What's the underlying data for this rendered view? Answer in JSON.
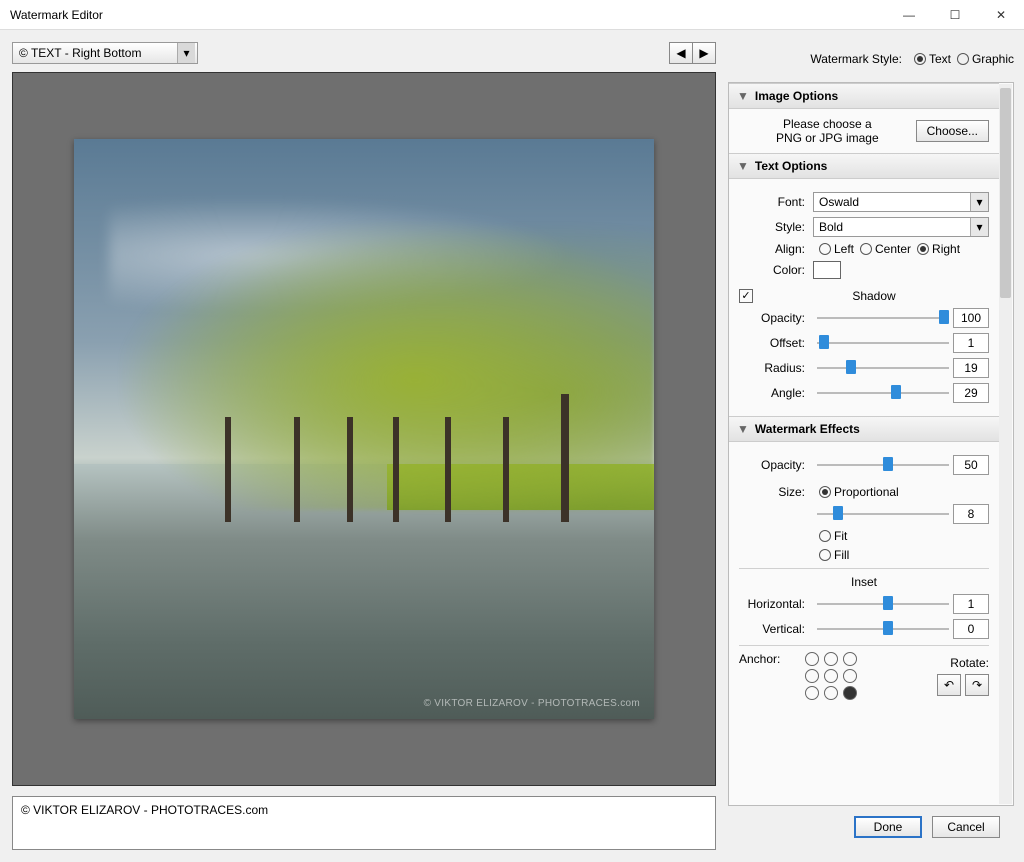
{
  "window": {
    "title": "Watermark Editor"
  },
  "preset": {
    "selected": "© TEXT - Right Bottom"
  },
  "watermarkText": "© VIKTOR ELIZAROV - PHOTOTRACES.com",
  "previewWatermark": "© VIKTOR ELIZAROV - PHOTOTRACES.com",
  "styleRow": {
    "label": "Watermark Style:",
    "text": "Text",
    "graphic": "Graphic",
    "selected": "Text"
  },
  "sections": {
    "imageOptions": {
      "title": "Image Options",
      "hint1": "Please choose a",
      "hint2": "PNG or JPG image",
      "choose": "Choose..."
    },
    "textOptions": {
      "title": "Text Options",
      "fontLabel": "Font:",
      "fontValue": "Oswald",
      "styleLabel": "Style:",
      "styleValue": "Bold",
      "alignLabel": "Align:",
      "alignLeft": "Left",
      "alignCenter": "Center",
      "alignRight": "Right",
      "alignSelected": "Right",
      "colorLabel": "Color:",
      "colorValue": "#ffffff",
      "shadow": {
        "label": "Shadow",
        "enabled": true,
        "opacityLabel": "Opacity:",
        "opacity": 100,
        "offsetLabel": "Offset:",
        "offset": 1,
        "radiusLabel": "Radius:",
        "radius": 19,
        "angleLabel": "Angle:",
        "angle": 29
      }
    },
    "effects": {
      "title": "Watermark Effects",
      "opacityLabel": "Opacity:",
      "opacity": 50,
      "sizeLabel": "Size:",
      "sizeProp": "Proportional",
      "sizeFit": "Fit",
      "sizeFill": "Fill",
      "sizeSelected": "Proportional",
      "sizeValue": 8,
      "inset": {
        "label": "Inset",
        "horizLabel": "Horizontal:",
        "horizontal": 1,
        "vertLabel": "Vertical:",
        "vertical": 0
      },
      "anchorLabel": "Anchor:",
      "anchorSelected": 8,
      "rotateLabel": "Rotate:"
    }
  },
  "footer": {
    "done": "Done",
    "cancel": "Cancel"
  }
}
